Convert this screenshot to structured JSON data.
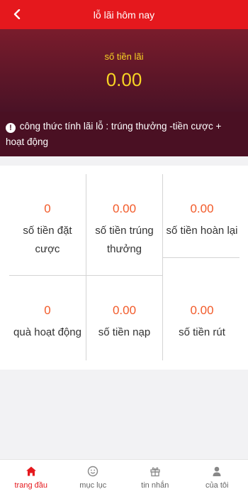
{
  "header": {
    "title": "lỗ lãi hôm nay"
  },
  "summary": {
    "label": "số tiền lãi",
    "amount": "0.00"
  },
  "formula": {
    "text": "công thức tính lãi lỗ : trúng thưởng -tiền cược + hoạt động"
  },
  "stats": [
    {
      "value": "0",
      "label": "số tiền đặt cược"
    },
    {
      "value": "0.00",
      "label": "số tiền trúng thưởng"
    },
    {
      "value": "0.00",
      "label": "số tiền hoàn lại"
    },
    {
      "value": "0",
      "label": "quà hoạt động"
    },
    {
      "value": "0.00",
      "label": "số tiền nạp"
    },
    {
      "value": "0.00",
      "label": "số tiền rút"
    }
  ],
  "tabbar": [
    {
      "label": "trang đầu",
      "icon": "home-icon",
      "active": true
    },
    {
      "label": "mục lục",
      "icon": "smiley-icon",
      "active": false
    },
    {
      "label": "tin nhắn",
      "icon": "gift-icon",
      "active": false
    },
    {
      "label": "của tôi",
      "icon": "user-icon",
      "active": false
    }
  ],
  "colors": {
    "header": "#e5181d",
    "accent_value": "#f25a29",
    "amount": "#f7d324",
    "hero": "#5c1628"
  }
}
